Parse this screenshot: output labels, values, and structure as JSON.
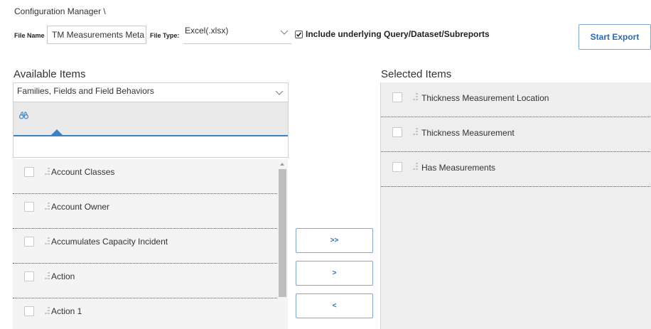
{
  "breadcrumb": "Configuration Manager \\",
  "toolbar": {
    "file_name_label": "File Name",
    "file_name_value": "TM Measurements Meta",
    "file_type_label": "File Type:",
    "file_type_value": "Excel(.xlsx)",
    "include_label": "Include underlying Query/Dataset/Subreports",
    "include_checked": true,
    "start_export_label": "Start Export"
  },
  "available": {
    "title": "Available Items",
    "category_value": "Families, Fields and Field Behaviors",
    "search_value": "",
    "items": [
      {
        "label": "Account Classes",
        "checked": false
      },
      {
        "label": "Account Owner",
        "checked": false
      },
      {
        "label": "Accumulates Capacity Incident",
        "checked": false
      },
      {
        "label": "Action",
        "checked": false
      },
      {
        "label": "Action 1",
        "checked": false
      }
    ]
  },
  "move_buttons": {
    "add_all": ">>",
    "add": ">",
    "remove": "<"
  },
  "selected": {
    "title": "Selected Items",
    "items": [
      {
        "label": "Thickness Measurement Location",
        "checked": false
      },
      {
        "label": "Thickness Measurement",
        "checked": false
      },
      {
        "label": "Has Measurements",
        "checked": false
      }
    ]
  },
  "icons": {
    "search": "binoculars-icon",
    "item": "family-field-icon",
    "dropdown": "chevron-down-icon"
  },
  "colors": {
    "accent": "#3b82c4",
    "button_text": "#2a6cb0",
    "button_border": "#7fa7d4"
  }
}
